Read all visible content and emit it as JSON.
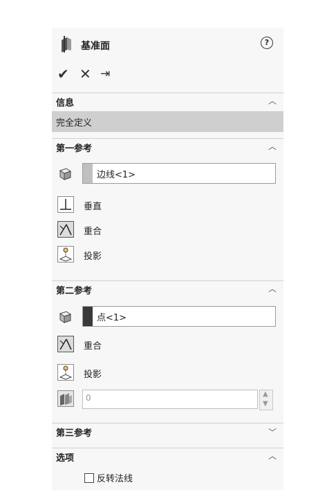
{
  "header": {
    "title": "基准面",
    "help": "?"
  },
  "actions": {
    "ok": "✔",
    "cancel": "✕",
    "pin": "⇥"
  },
  "info": {
    "heading": "信息",
    "status": "完全定义"
  },
  "first_ref": {
    "heading": "第一参考",
    "selection": "边线<1>",
    "swatch_color": "#c0c0c0",
    "options": [
      {
        "label": "垂直"
      },
      {
        "label": "重合"
      },
      {
        "label": "投影"
      }
    ]
  },
  "second_ref": {
    "heading": "第二参考",
    "selection": "点<1>",
    "swatch_color": "#3a3a3a",
    "options": [
      {
        "label": "重合"
      },
      {
        "label": "投影"
      }
    ],
    "count_value": "0"
  },
  "third_ref": {
    "heading": "第三参考"
  },
  "options": {
    "heading": "选项",
    "flip_normal": "反转法线"
  }
}
